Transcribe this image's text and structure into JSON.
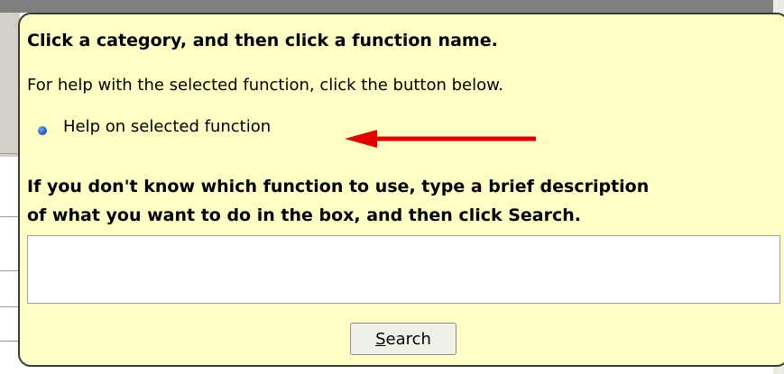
{
  "balloon": {
    "heading": "Click a category, and then click a function name.",
    "help_text": "For help with the selected function, click the button below.",
    "help_link_label": "Help on selected function",
    "search_heading_line1": "If you don't know which function to use, type a brief description",
    "search_heading_line2": "of what you want to do in the box, and then click Search.",
    "search_value": "",
    "search_button_accel": "S",
    "search_button_rest": "earch"
  },
  "colors": {
    "balloon_bg": "#ffffc6",
    "arrow": "#e00000",
    "bullet": "#1a4fb8"
  }
}
